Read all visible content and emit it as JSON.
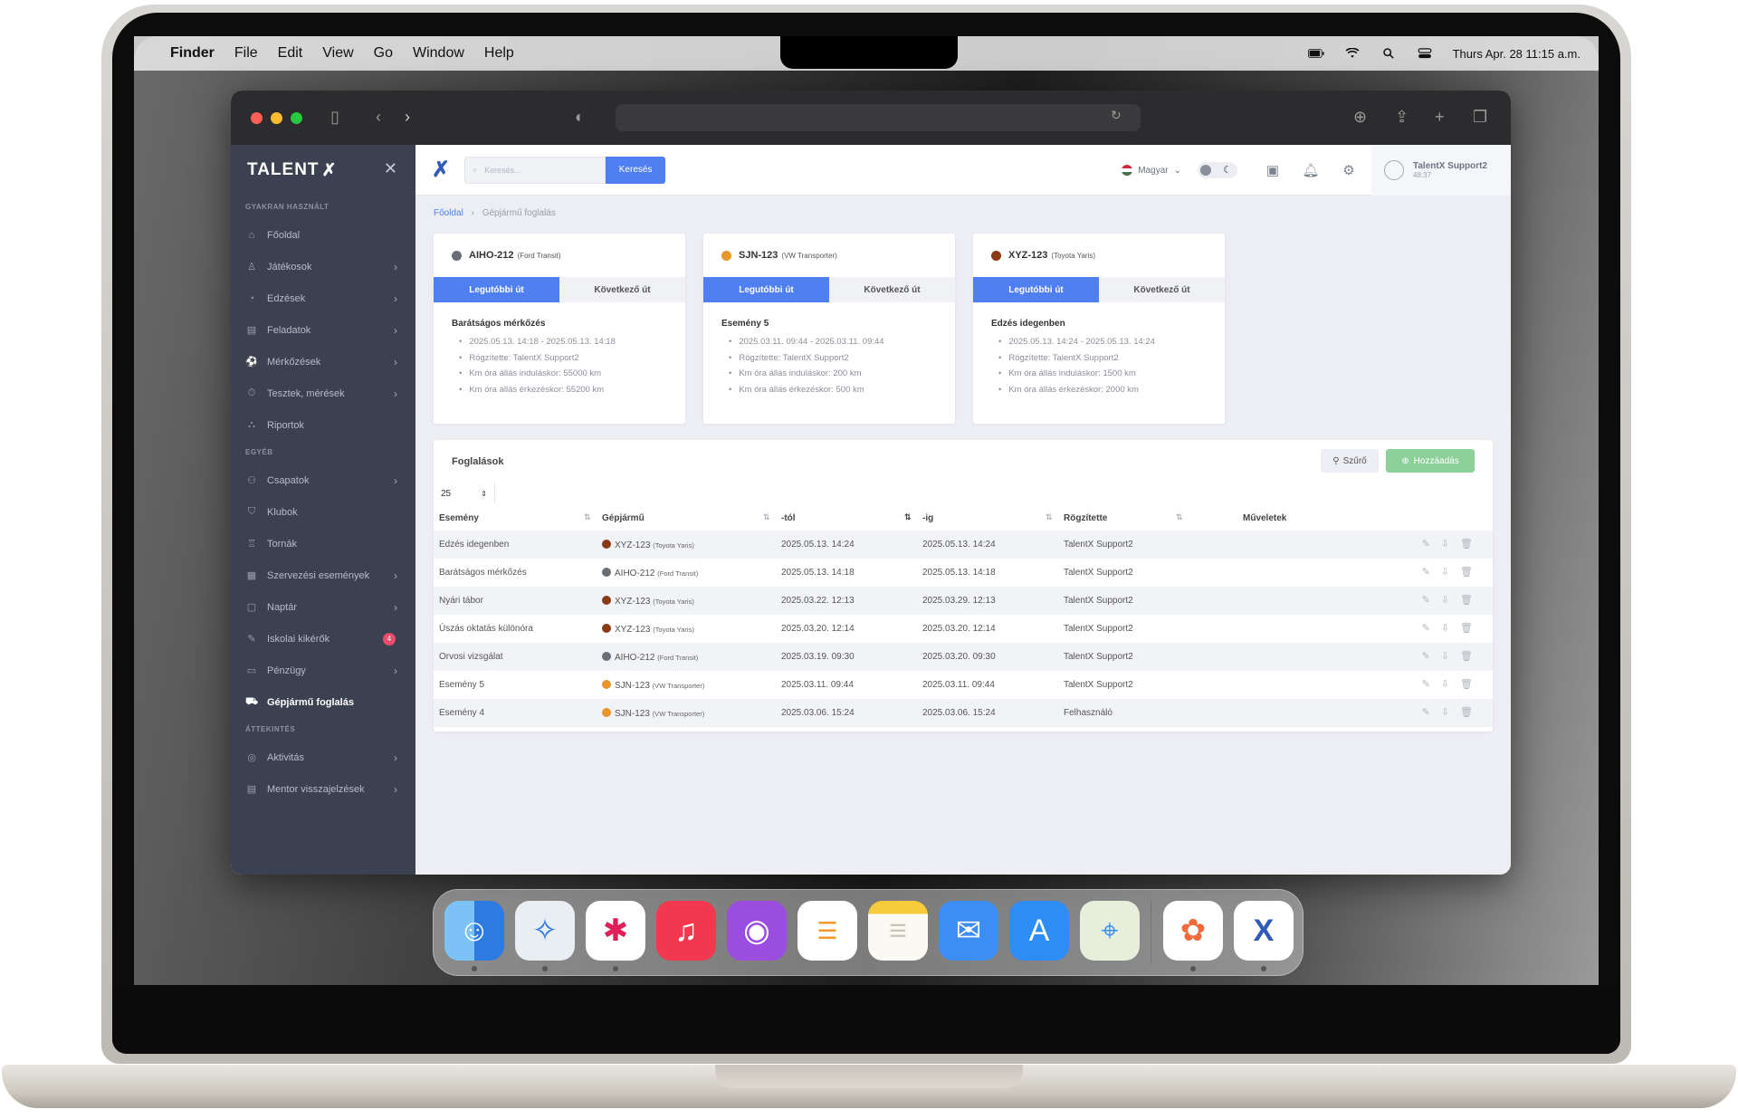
{
  "menubar": {
    "apple": "",
    "items": [
      "Finder",
      "File",
      "Edit",
      "View",
      "Go",
      "Window",
      "Help"
    ],
    "clock": "Thurs Apr. 28 11:15 a.m."
  },
  "sidebar": {
    "logo": "TALENT",
    "sections": {
      "frequent": "GYAKRAN HASZNÁLT",
      "other": "EGYÉB",
      "overview": "ÁTTEKINTÉS"
    },
    "items": [
      {
        "label": "Főoldal",
        "icon": "home-icon"
      },
      {
        "label": "Játékosok",
        "icon": "player-icon"
      },
      {
        "label": "Edzések",
        "icon": "training-icon"
      },
      {
        "label": "Feladatok",
        "icon": "tasks-icon"
      },
      {
        "label": "Mérkőzések",
        "icon": "ball-icon"
      },
      {
        "label": "Tesztek, mérések",
        "icon": "stopwatch-icon"
      },
      {
        "label": "Riportok",
        "icon": "report-icon"
      },
      {
        "label": "Csapatok",
        "icon": "teams-icon"
      },
      {
        "label": "Klubok",
        "icon": "shield-icon"
      },
      {
        "label": "Tornák",
        "icon": "trophy-icon"
      },
      {
        "label": "Szervezési események",
        "icon": "calendar-events-icon"
      },
      {
        "label": "Naptár",
        "icon": "calendar-icon"
      },
      {
        "label": "Iskolai kikérők",
        "icon": "school-icon",
        "badge": "4"
      },
      {
        "label": "Pénzügy",
        "icon": "money-icon"
      },
      {
        "label": "Gépjármű foglalás",
        "icon": "bus-icon"
      },
      {
        "label": "Aktivitás",
        "icon": "activity-icon"
      },
      {
        "label": "Mentor visszajelzések",
        "icon": "feedback-icon"
      }
    ]
  },
  "topbar": {
    "search_placeholder": "Keresés...",
    "search_button": "Keresés",
    "language": "Magyar",
    "user_name": "TalentX Support2",
    "user_time": "48:37"
  },
  "breadcrumb": {
    "home": "Főoldal",
    "current": "Gépjármű foglalás"
  },
  "vehicles": [
    {
      "plate": "AIHO-212",
      "model": "(Ford Transit)",
      "color": "#6b6e76",
      "tab_last": "Legutóbbi út",
      "tab_next": "Következő út",
      "title": "Barátságos mérkőzés",
      "details": [
        "2025.05.13. 14:18 - 2025.05.13. 14:18",
        "Rögzítette: TalentX Support2",
        "Km óra állás induláskor: 55000 km",
        "Km óra állás érkezéskor: 55200 km"
      ]
    },
    {
      "plate": "SJN-123",
      "model": "(VW Transporter)",
      "color": "#e8952b",
      "tab_last": "Legutóbbi út",
      "tab_next": "Következő út",
      "title": "Esemény 5",
      "details": [
        "2025.03.11. 09:44 - 2025.03.11. 09:44",
        "Rögzítette: TalentX Support2",
        "Km óra állás induláskor: 200 km",
        "Km óra állás érkezéskor: 500 km"
      ]
    },
    {
      "plate": "XYZ-123",
      "model": "(Toyota Yaris)",
      "color": "#8a3a16",
      "tab_last": "Legutóbbi út",
      "tab_next": "Következő út",
      "title": "Edzés idegenben",
      "details": [
        "2025.05.13. 14:24 - 2025.05.13. 14:24",
        "Rögzítette: TalentX Support2",
        "Km óra állás induláskor: 1500 km",
        "Km óra állás érkezéskor: 2000 km"
      ]
    }
  ],
  "bookings": {
    "title": "Foglalások",
    "filter": "Szűrő",
    "add": "Hozzáadás",
    "page_size": "25",
    "columns": [
      "Esemény",
      "Gépjármű",
      "-tól",
      "-ig",
      "Rögzítette",
      "Műveletek"
    ],
    "rows": [
      {
        "event": "Edzés idegenben",
        "plate": "XYZ-123",
        "model": "(Toyota Yaris)",
        "color": "#8a3a16",
        "from": "2025.05.13. 14:24",
        "to": "2025.05.13. 14:24",
        "by": "TalentX Support2"
      },
      {
        "event": "Barátságos mérkőzés",
        "plate": "AIHO-212",
        "model": "(Ford Transit)",
        "color": "#6b6e76",
        "from": "2025.05.13. 14:18",
        "to": "2025.05.13. 14:18",
        "by": "TalentX Support2"
      },
      {
        "event": "Nyári tábor",
        "plate": "XYZ-123",
        "model": "(Toyota Yaris)",
        "color": "#8a3a16",
        "from": "2025.03.22. 12:13",
        "to": "2025.03.29. 12:13",
        "by": "TalentX Support2"
      },
      {
        "event": "Úszás oktatás különóra",
        "plate": "XYZ-123",
        "model": "(Toyota Yaris)",
        "color": "#8a3a16",
        "from": "2025.03.20. 12:14",
        "to": "2025.03.20. 12:14",
        "by": "TalentX Support2"
      },
      {
        "event": "Orvosi vizsgálat",
        "plate": "AIHO-212",
        "model": "(Ford Transit)",
        "color": "#6b6e76",
        "from": "2025.03.19. 09:30",
        "to": "2025.03.20. 09:30",
        "by": "TalentX Support2"
      },
      {
        "event": "Esemény 5",
        "plate": "SJN-123",
        "model": "(VW Transporter)",
        "color": "#e8952b",
        "from": "2025.03.11. 09:44",
        "to": "2025.03.11. 09:44",
        "by": "TalentX Support2"
      },
      {
        "event": "Esemény 4",
        "plate": "SJN-123",
        "model": "(VW Transporter)",
        "color": "#e8952b",
        "from": "2025.03.06. 15:24",
        "to": "2025.03.06. 15:24",
        "by": "Felhasználó"
      }
    ]
  },
  "dock": [
    {
      "name": "finder-icon",
      "bg": "#3b8cf0",
      "glyph": "☺"
    },
    {
      "name": "safari-icon",
      "bg": "#e9eef5",
      "glyph": "🧭"
    },
    {
      "name": "slack-icon",
      "bg": "#ffffff",
      "glyph": "✱"
    },
    {
      "name": "music-icon",
      "bg": "#f2384f",
      "glyph": "♫"
    },
    {
      "name": "podcasts-icon",
      "bg": "#9b4de0",
      "glyph": "◉"
    },
    {
      "name": "reminders-icon",
      "bg": "#ffffff",
      "glyph": "☰"
    },
    {
      "name": "notes-icon",
      "bg": "#fbfaf2",
      "glyph": "≡"
    },
    {
      "name": "mail-icon",
      "bg": "#3d8ef4",
      "glyph": "✉"
    },
    {
      "name": "app-store-icon",
      "bg": "#2d8cf5",
      "glyph": "A"
    },
    {
      "name": "maps-icon",
      "bg": "#e7efdc",
      "glyph": "⌖"
    },
    {
      "name": "photos-icon",
      "bg": "#ffffff",
      "glyph": "✿"
    },
    {
      "name": "talentx-icon",
      "bg": "#ffffff",
      "glyph": "X"
    }
  ]
}
